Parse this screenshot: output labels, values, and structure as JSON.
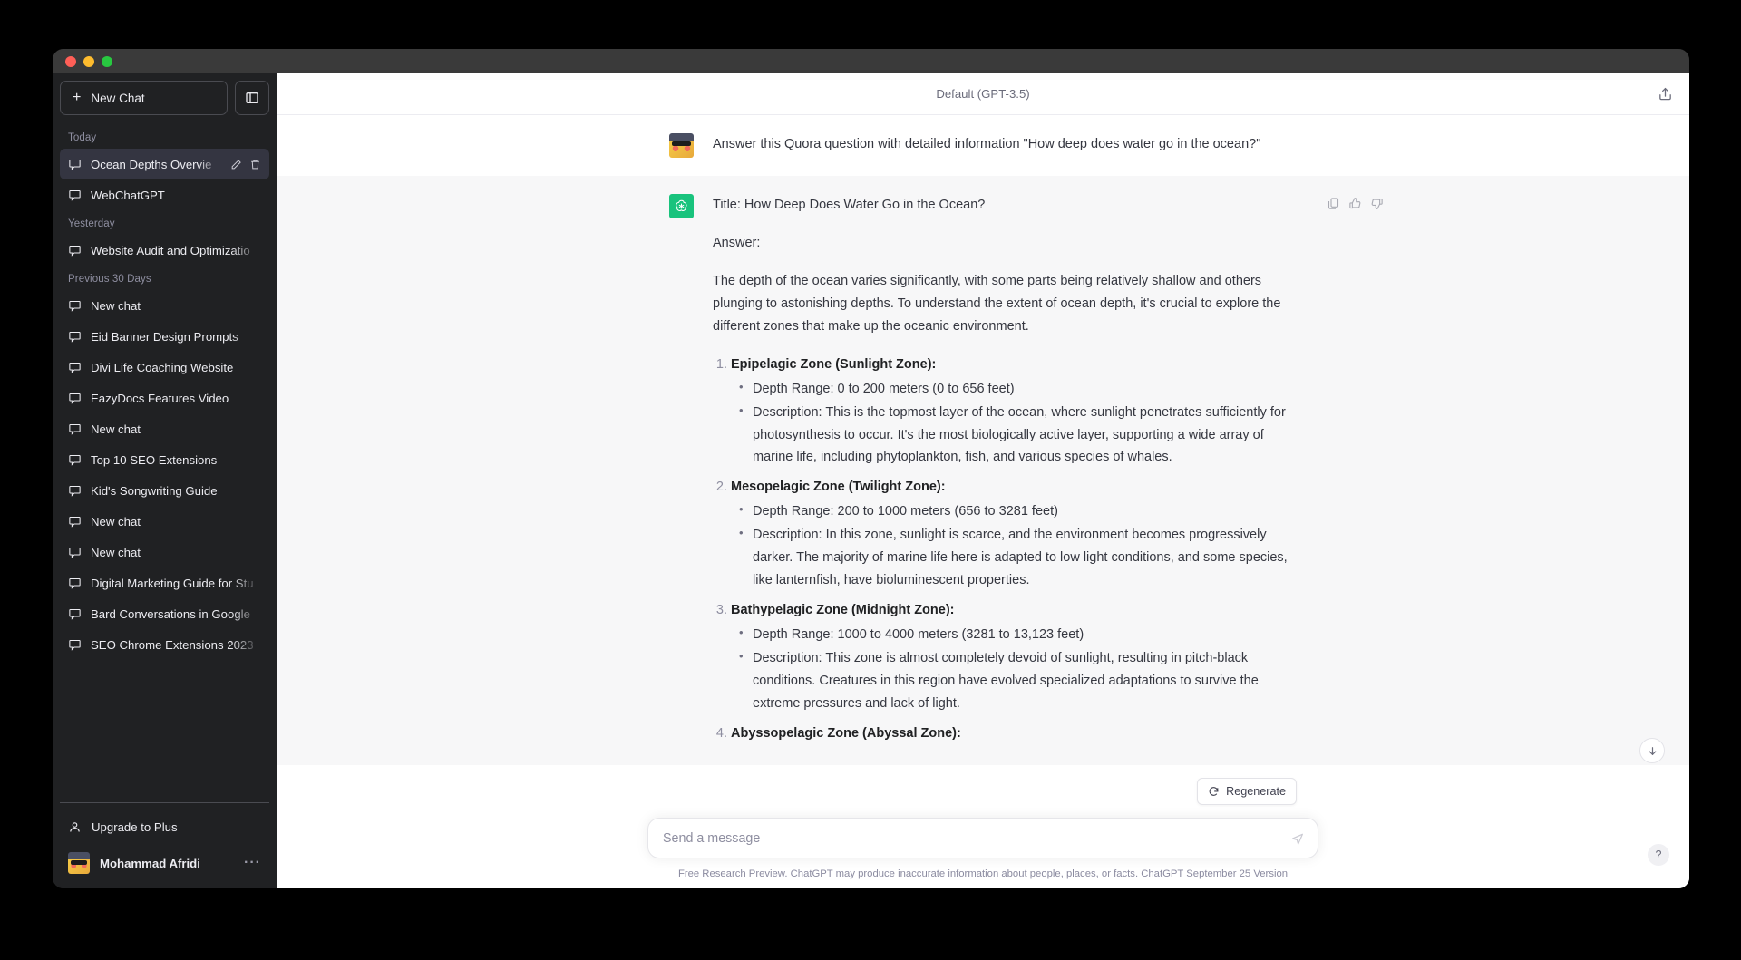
{
  "window": {
    "traffic_lights": [
      "close",
      "minimize",
      "maximize"
    ]
  },
  "sidebar": {
    "new_chat_label": "New Chat",
    "collapse_icon": "sidebar-toggle-icon",
    "groups": [
      {
        "label": "Today",
        "items": [
          {
            "title": "Ocean Depths Overvie",
            "active": true,
            "icon": "chat-bubble-icon",
            "actions": [
              "edit-icon",
              "trash-icon"
            ]
          },
          {
            "title": "WebChatGPT",
            "active": false,
            "icon": "chat-bubble-icon"
          }
        ]
      },
      {
        "label": "Yesterday",
        "items": [
          {
            "title": "Website Audit and Optimizatio",
            "active": false,
            "icon": "chat-bubble-icon"
          }
        ]
      },
      {
        "label": "Previous 30 Days",
        "items": [
          {
            "title": "New chat",
            "active": false,
            "icon": "chat-bubble-icon"
          },
          {
            "title": "Eid Banner Design Prompts",
            "active": false,
            "icon": "chat-bubble-icon"
          },
          {
            "title": "Divi Life Coaching Website",
            "active": false,
            "icon": "chat-bubble-icon"
          },
          {
            "title": "EazyDocs Features Video",
            "active": false,
            "icon": "chat-bubble-icon"
          },
          {
            "title": "New chat",
            "active": false,
            "icon": "chat-bubble-icon"
          },
          {
            "title": "Top 10 SEO Extensions",
            "active": false,
            "icon": "chat-bubble-icon"
          },
          {
            "title": "Kid's Songwriting Guide",
            "active": false,
            "icon": "chat-bubble-icon"
          },
          {
            "title": "New chat",
            "active": false,
            "icon": "chat-bubble-icon"
          },
          {
            "title": "New chat",
            "active": false,
            "icon": "chat-bubble-icon"
          },
          {
            "title": "Digital Marketing Guide for Stu",
            "active": false,
            "icon": "chat-bubble-icon"
          },
          {
            "title": "Bard Conversations in Google",
            "active": false,
            "icon": "chat-bubble-icon"
          },
          {
            "title": "SEO Chrome Extensions 2023",
            "active": false,
            "icon": "chat-bubble-icon"
          }
        ]
      }
    ],
    "upgrade_label": "Upgrade to Plus",
    "account_name": "Mohammad Afridi",
    "account_menu_glyph": "···"
  },
  "header": {
    "model_label": "Default (GPT-3.5)",
    "share_icon": "share-export-icon"
  },
  "conversation": {
    "user_message": "Answer this Quora question with detailed information \"How deep does water go in the ocean?\"",
    "assistant": {
      "title_line": "Title: How Deep Does Water Go in the Ocean?",
      "answer_label": "Answer:",
      "intro": "The depth of the ocean varies significantly, with some parts being relatively shallow and others plunging to astonishing depths. To understand the extent of ocean depth, it's crucial to explore the different zones that make up the oceanic environment.",
      "zones": [
        {
          "heading": "Epipelagic Zone (Sunlight Zone):",
          "depth_range": "Depth Range: 0 to 200 meters (0 to 656 feet)",
          "description": "Description: This is the topmost layer of the ocean, where sunlight penetrates sufficiently for photosynthesis to occur. It's the most biologically active layer, supporting a wide array of marine life, including phytoplankton, fish, and various species of whales."
        },
        {
          "heading": "Mesopelagic Zone (Twilight Zone):",
          "depth_range": "Depth Range: 200 to 1000 meters (656 to 3281 feet)",
          "description": "Description: In this zone, sunlight is scarce, and the environment becomes progressively darker. The majority of marine life here is adapted to low light conditions, and some species, like lanternfish, have bioluminescent properties."
        },
        {
          "heading": "Bathypelagic Zone (Midnight Zone):",
          "depth_range": "Depth Range: 1000 to 4000 meters (3281 to 13,123 feet)",
          "description": "Description: This zone is almost completely devoid of sunlight, resulting in pitch-black conditions. Creatures in this region have evolved specialized adaptations to survive the extreme pressures and lack of light."
        },
        {
          "heading": "Abyssopelagic Zone (Abyssal Zone):",
          "depth_range": "",
          "description": ""
        }
      ],
      "actions": [
        "copy-icon",
        "thumbs-up-icon",
        "thumbs-down-icon"
      ]
    }
  },
  "composer": {
    "regenerate_label": "Regenerate",
    "regenerate_icon": "refresh-icon",
    "input_placeholder": "Send a message",
    "input_value": "",
    "send_icon": "send-arrow-icon",
    "footnote_text": "Free Research Preview. ChatGPT may produce inaccurate information about people, places, or facts.",
    "footnote_link": "ChatGPT September 25 Version",
    "scroll_down_icon": "arrow-down-icon",
    "help_label": "?"
  },
  "colors": {
    "accent_green": "#19c37d",
    "sidebar_bg": "#202123",
    "active_item": "#343541",
    "assistant_bg": "#f7f7f8"
  }
}
